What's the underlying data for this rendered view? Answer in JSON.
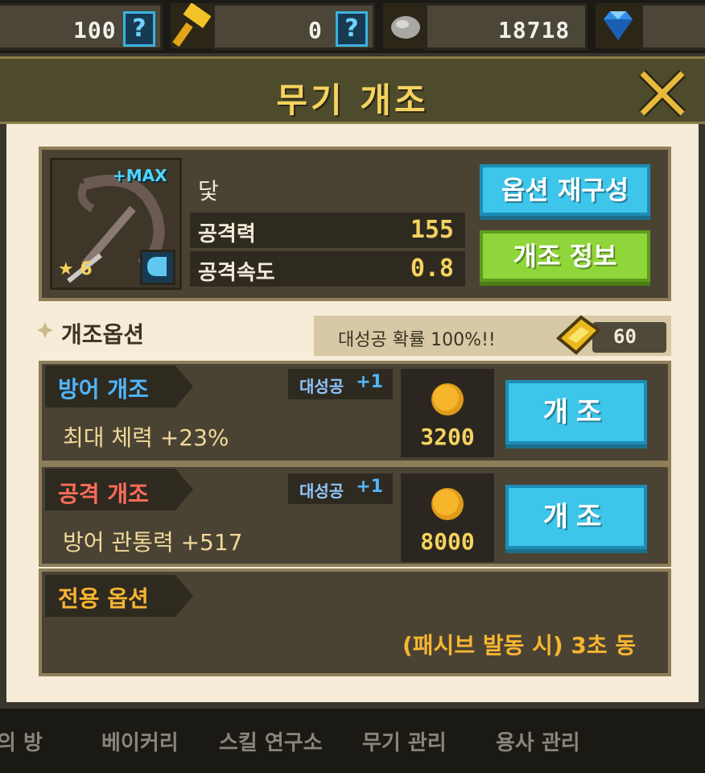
{
  "top_bar": {
    "question_count": "100",
    "hammer_count": "0",
    "stone_count": "18718"
  },
  "modal": {
    "title": "무기 개조"
  },
  "weapon": {
    "name": "닻",
    "max_label": "+MAX",
    "star_level": "6",
    "stats": [
      {
        "label": "공격력",
        "value": "155"
      },
      {
        "label": "공격속도",
        "value": "0.8"
      }
    ],
    "reroll_button": "옵션 재구성",
    "info_button": "개조 정보"
  },
  "options_section": {
    "title": "개조옵션",
    "success_rate_text": "대성공 확률 100%!!",
    "ticket_count": "60"
  },
  "options": [
    {
      "tag": "방어 개조",
      "tag_color": "#4fb6ff",
      "crit_label": "대성공",
      "crit_bonus": "+1",
      "description": "최대 체력 +23%",
      "cost": "3200",
      "button": "개조"
    },
    {
      "tag": "공격 개조",
      "tag_color": "#ff6b5a",
      "crit_label": "대성공",
      "crit_bonus": "+1",
      "description": "방어 관통력 +517",
      "cost": "8000",
      "button": "개조"
    }
  ],
  "special_option": {
    "tag": "전용 옵션",
    "description": "(패시브 발동 시) 3초 동"
  },
  "bottom_nav": [
    "의 방",
    "베이커리",
    "스킬 연구소",
    "무기 관리",
    "용사 관리"
  ]
}
